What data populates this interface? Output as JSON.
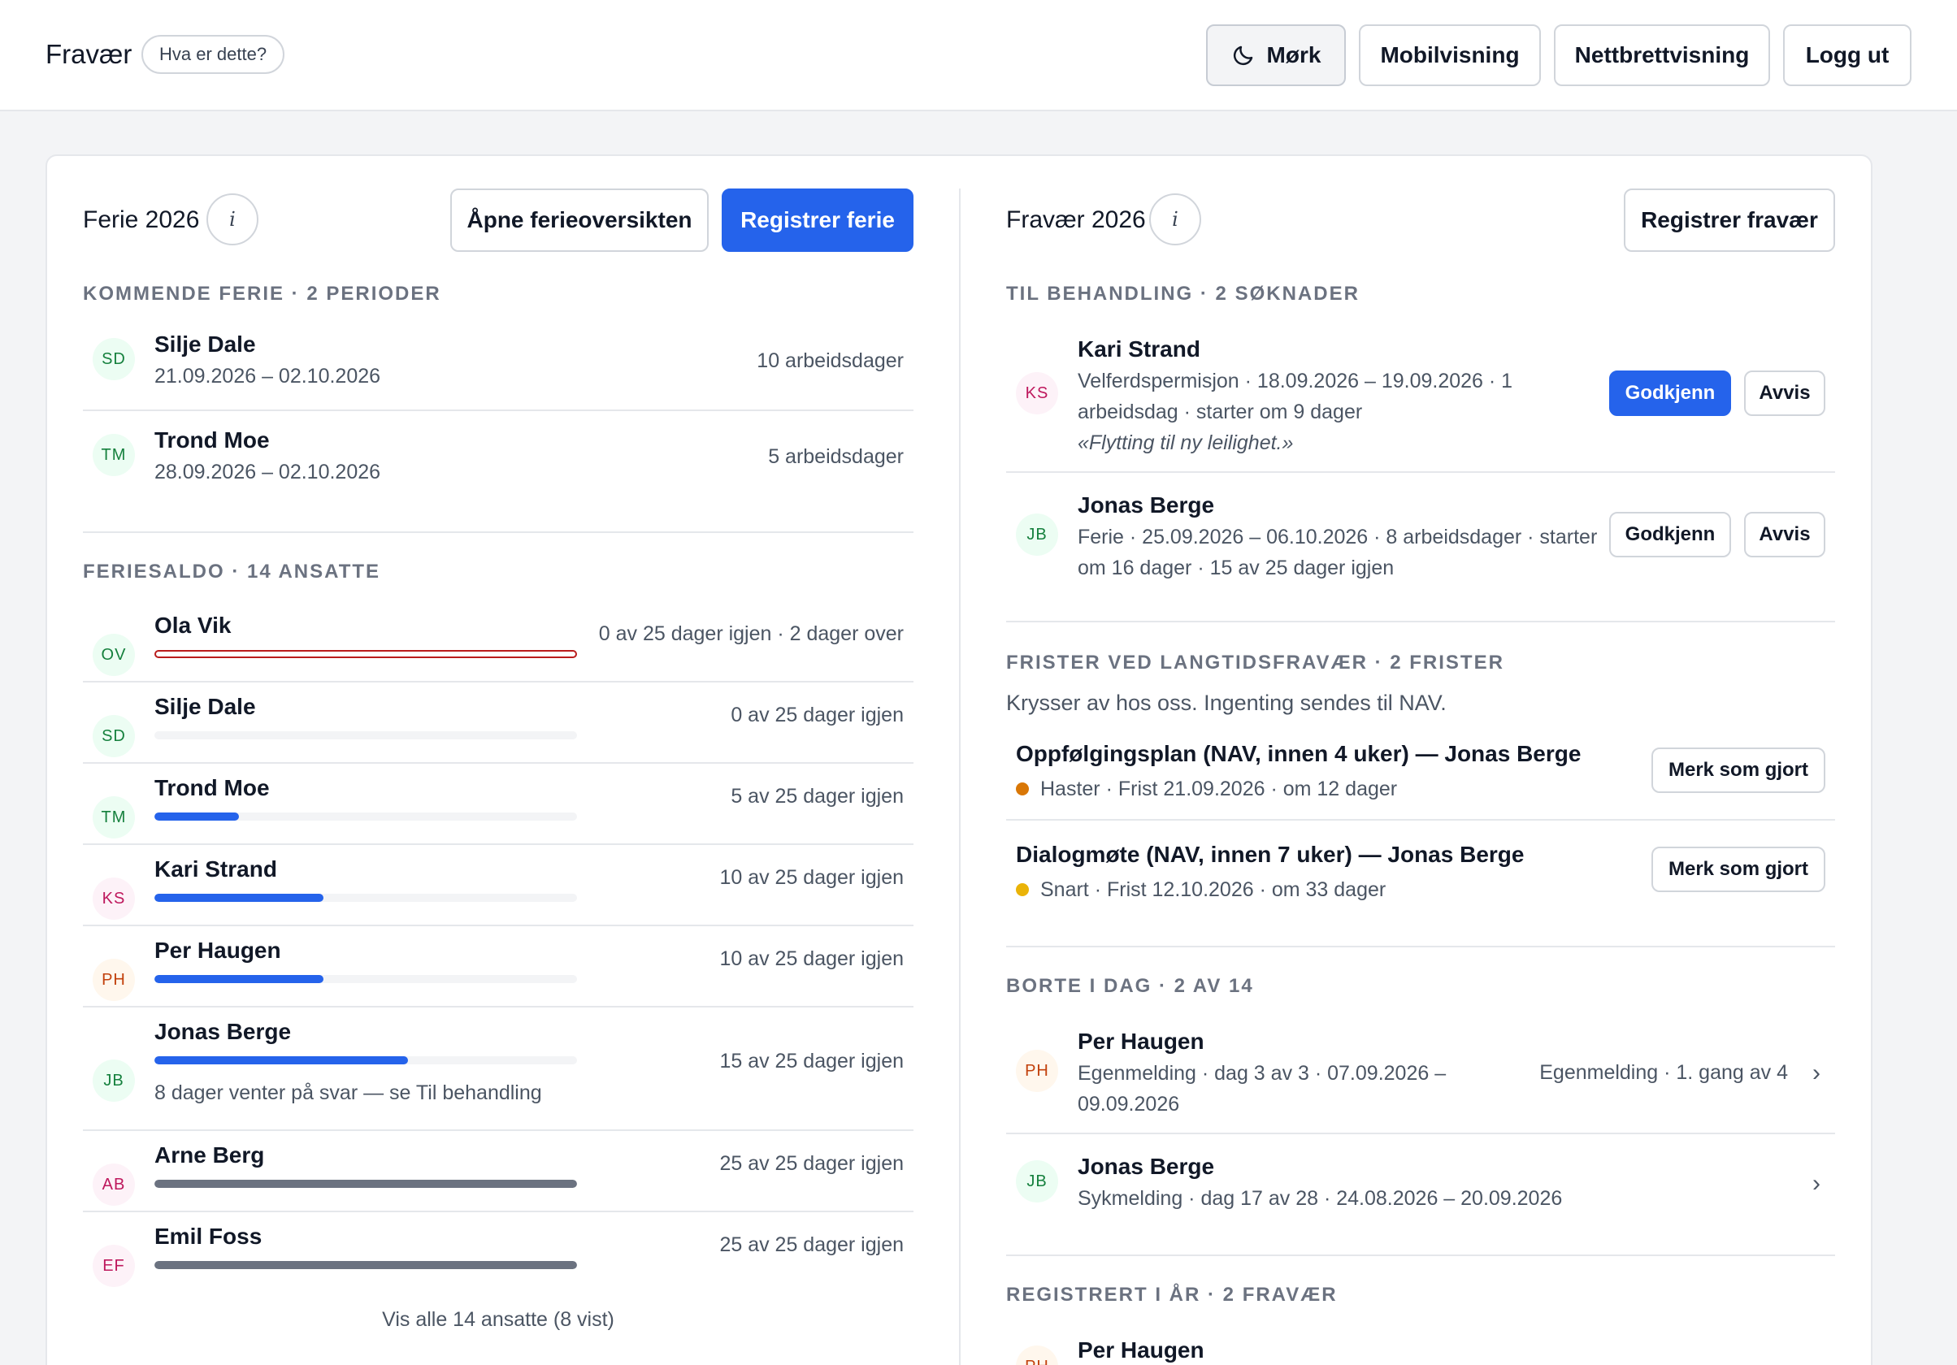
{
  "header": {
    "title": "Fravær",
    "help_pill": "Hva er dette?",
    "buttons": {
      "dark": "Mørk",
      "mobile": "Mobilvisning",
      "tablet": "Nettbrettvisning",
      "logout": "Logg ut"
    }
  },
  "vacation": {
    "title": "Ferie 2026",
    "info_glyph": "i",
    "open_overview": "Åpne ferieoversikten",
    "register": "Registrer ferie",
    "upcoming": {
      "label": "KOMMENDE FERIE · 2 PERIODER",
      "items": [
        {
          "initials": "SD",
          "name": "Silje Dale",
          "dates": "21.09.2026 – 02.10.2026",
          "days": "10 arbeidsdager"
        },
        {
          "initials": "TM",
          "name": "Trond Moe",
          "dates": "28.09.2026 – 02.10.2026",
          "days": "5 arbeidsdager"
        }
      ]
    },
    "balance": {
      "label": "FERIESALDO · 14 ANSATTE",
      "items": [
        {
          "initials": "OV",
          "name": "Ola Vik",
          "text": "0 av 25 dager igjen · 2 dager over",
          "remaining": 0,
          "over": true,
          "color": "#b91c1c"
        },
        {
          "initials": "SD",
          "name": "Silje Dale",
          "text": "0 av 25 dager igjen",
          "remaining": 0,
          "color": "#2563eb"
        },
        {
          "initials": "TM",
          "name": "Trond Moe",
          "text": "5 av 25 dager igjen",
          "remaining": 5,
          "color": "#2563eb"
        },
        {
          "initials": "KS",
          "name": "Kari Strand",
          "text": "10 av 25 dager igjen",
          "remaining": 10,
          "color": "#2563eb"
        },
        {
          "initials": "PH",
          "name": "Per Haugen",
          "text": "10 av 25 dager igjen",
          "remaining": 10,
          "color": "#2563eb"
        },
        {
          "initials": "JB",
          "name": "Jonas Berge",
          "text": "15 av 25 dager igjen",
          "remaining": 15,
          "color": "#2563eb",
          "note": "8 dager venter på svar — se Til behandling"
        },
        {
          "initials": "AB",
          "name": "Arne Berg",
          "text": "25 av 25 dager igjen",
          "remaining": 25,
          "color": "#6b7280"
        },
        {
          "initials": "EF",
          "name": "Emil Foss",
          "text": "25 av 25 dager igjen",
          "remaining": 25,
          "color": "#6b7280"
        }
      ],
      "total": 25,
      "show_all": "Vis alle 14 ansatte (8 vist)"
    }
  },
  "absence": {
    "title": "Fravær 2026",
    "info_glyph": "i",
    "register": "Registrer fravær",
    "pending": {
      "label": "TIL BEHANDLING · 2 SØKNADER",
      "approve": "Godkjenn",
      "reject": "Avvis",
      "items": [
        {
          "initials": "KS",
          "name": "Kari Strand",
          "line1": "Velferdspermisjon · 18.09.2026 – 19.09.2026 · 1",
          "line2": "arbeidsdag · starter om 9 dager",
          "quote": "«Flytting til ny leilighet.»"
        },
        {
          "initials": "JB",
          "name": "Jonas Berge",
          "line1": "Ferie · 25.09.2026 – 06.10.2026 · 8 arbeidsdager · starter",
          "line2": "om 16 dager · 15 av 25 dager igjen"
        }
      ]
    },
    "deadlines": {
      "label": "FRISTER VED LANGTIDSFRAVÆR · 2 FRISTER",
      "intro": "Krysser av hos oss. Ingenting sendes til NAV.",
      "mark_done": "Merk som gjort",
      "items": [
        {
          "title": "Oppfølgingsplan (NAV, innen 4 uker) — Jonas Berge",
          "status": "Haster · Frist 21.09.2026 · om 12 dager",
          "color": "#d97706"
        },
        {
          "title": "Dialogmøte (NAV, innen 7 uker) — Jonas Berge",
          "status": "Snart · Frist 12.10.2026 · om 33 dager",
          "color": "#eab308"
        }
      ]
    },
    "away_today": {
      "label": "BORTE I DAG · 2 AV 14",
      "items": [
        {
          "initials": "PH",
          "name": "Per Haugen",
          "line1": "Egenmelding · dag 3 av 3 · 07.09.2026 –",
          "line2": "09.09.2026",
          "right": "Egenmelding · 1. gang av 4"
        },
        {
          "initials": "JB",
          "name": "Jonas Berge",
          "line1": "Sykmelding · dag 17 av 28 · 24.08.2026 – 20.09.2026"
        }
      ]
    },
    "registered": {
      "label": "REGISTRERT I ÅR · 2 FRAVÆR",
      "items": [
        {
          "initials": "PH",
          "name": "Per Haugen"
        }
      ]
    }
  },
  "icons": {
    "moon": "moon-icon",
    "info": "info-icon",
    "chevron": "chevron-right-icon"
  }
}
